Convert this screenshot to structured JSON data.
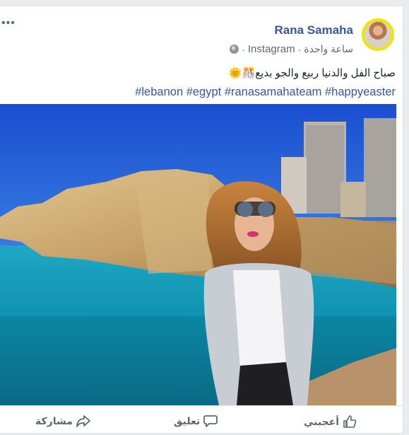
{
  "post": {
    "author": "Rana Samaha",
    "source": "Instagram",
    "separator": "·",
    "time": "ساعة واحدة",
    "text": "صباح الفل والدنيا ربيع والجو بديع",
    "emoji": "🎊🌞",
    "hashtags": "#lebanon #egypt #ranasamahateam #happyeaster"
  },
  "actions": {
    "like": "أعجبني",
    "comment": "تعليق",
    "share": "مشاركة"
  },
  "icons": {
    "more": "more-options-icon",
    "privacy": "globe-icon",
    "like": "thumbs-up-icon",
    "comment": "comment-icon",
    "share": "share-arrow-icon"
  },
  "colors": {
    "author": "#365899",
    "link": "#365899",
    "text": "#1d2129",
    "muted": "#606770"
  }
}
